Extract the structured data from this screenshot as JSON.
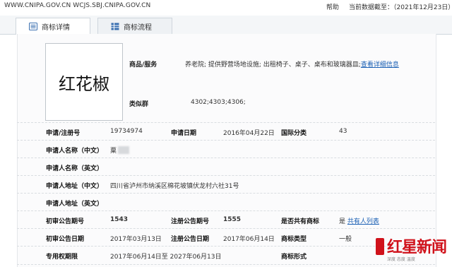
{
  "topbar": {
    "sites": "WWW.CNIPA.GOV.CN  WCJS.SBJ.CNIPA.GOV.CN",
    "help": "帮助",
    "date": "当前数据截至：（2021年12月23日）"
  },
  "tabs": [
    {
      "label": "商标详情",
      "icon": "document-icon",
      "active": true
    },
    {
      "label": "商标流程",
      "icon": "table-icon",
      "active": false
    }
  ],
  "trademark": {
    "image_text": "红花椒",
    "goods_label": "商品/服务",
    "goods_value": "养老院; 提供野营场地设施; 出租椅子、桌子、桌布和玻璃器皿;",
    "goods_link": "查看详细信息",
    "similar_label": "类似群",
    "similar_value": "4302;4303;4306;"
  },
  "details": {
    "reg_no_label": "申请/注册号",
    "reg_no": "19734974",
    "apply_date_label": "申请日期",
    "apply_date": "2016年04月22日",
    "intl_class_label": "国际分类",
    "intl_class": "43",
    "applicant_cn_label": "申请人名称（中文）",
    "applicant_cn": "粟",
    "applicant_en_label": "申请人名称（英文）",
    "address_cn_label": "申请人地址（中文）",
    "address_cn": "四川省泸州市纳溪区棉花坡镇伏龙村六社31号",
    "address_en_label": "申请人地址（英文）",
    "prelim_no_label": "初审公告期号",
    "prelim_no": "1543",
    "reg_pub_no_label": "注册公告期号",
    "reg_pub_no": "1555",
    "shared_label": "是否共有商标",
    "shared_value": "是",
    "shared_link": "共有人列表",
    "prelim_date_label": "初审公告日期",
    "prelim_date": "2017年03月13日",
    "reg_date_label": "注册公告日期",
    "reg_date": "2017年06月14日",
    "type_label": "商标类型",
    "type_value": "一般",
    "exclusive_label": "专用权期限",
    "exclusive_value": "2017年06月14日至 2027年06月13日",
    "form_label": "商标形式"
  },
  "watermark": {
    "title": "红星新闻",
    "subtitle": "深度 态度 温度"
  }
}
